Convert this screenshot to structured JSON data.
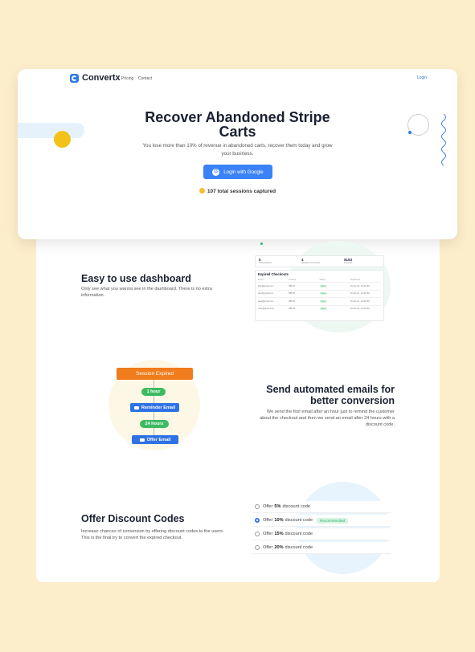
{
  "nav": {
    "brand": "Convertx",
    "links": [
      "Pricing",
      "Contact"
    ],
    "login": "Login"
  },
  "hero": {
    "title_line1": "Recover Abandoned Stripe",
    "title_line2": "Carts",
    "subtitle": "You lose more than 10% of revenue in abandoned carts, recover them today and grow your business.",
    "cta": "Login with Google",
    "sessions": "107 total sessions captured"
  },
  "dashboard": {
    "title": "Easy to use dashboard",
    "text": "Only see what you wanna see in the dashboard. There is no extra information.",
    "stats": [
      {
        "value": "5",
        "label": "Total sessions"
      },
      {
        "value": "4",
        "label": "Sessions recovered"
      },
      {
        "value": "$153",
        "label": "Revenue"
      }
    ],
    "table_title": "Expired Checkouts",
    "table_headers": [
      "Email",
      "Amount",
      "Status",
      "Created At"
    ],
    "rows": [
      {
        "email": "john@gmail.com",
        "amount": "$85.00",
        "status": "Sent",
        "date": "26 Jan 21, 12:30 PM"
      },
      {
        "email": "alex@gmail.com",
        "amount": "$85.00",
        "status": "Sent",
        "date": "26 Jan 21, 12:30 PM"
      },
      {
        "email": "sara@gmail.com",
        "amount": "$85.00",
        "status": "Sent",
        "date": "26 Jan 21, 12:30 PM"
      },
      {
        "email": "mike@gmail.com",
        "amount": "$85.00",
        "status": "Sent",
        "date": "26 Jan 21, 12:30 PM"
      }
    ]
  },
  "emails": {
    "title_line1": "Send automated emails for",
    "title_line2": "better conversion",
    "text": "We send the first email after an hour just to remind the customer about the checkout and then we send an email after 24 hours with a discount code.",
    "flow": {
      "start": "Session Expired",
      "delay1": "1 hour",
      "email1": "Reminder Email",
      "delay2": "24 hours",
      "email2": "Offer Email"
    }
  },
  "discount": {
    "title": "Offer Discount Codes",
    "text": "Increase chances of conversion by offering discount codes to the users. This is the final try to convert the expired checkout.",
    "options": [
      {
        "pre": "Offer",
        "pct": "5%",
        "post": "discount code",
        "selected": false
      },
      {
        "pre": "Offer",
        "pct": "10%",
        "post": "discount code",
        "selected": true,
        "badge": "Recommended"
      },
      {
        "pre": "Offer",
        "pct": "15%",
        "post": "discount code",
        "selected": false
      },
      {
        "pre": "Offer",
        "pct": "20%",
        "post": "discount code",
        "selected": false
      }
    ]
  },
  "colors": {
    "background": "#fdeecb",
    "primary": "#2f72e5",
    "accent": "#f07c1b",
    "success": "#3dbb62"
  }
}
